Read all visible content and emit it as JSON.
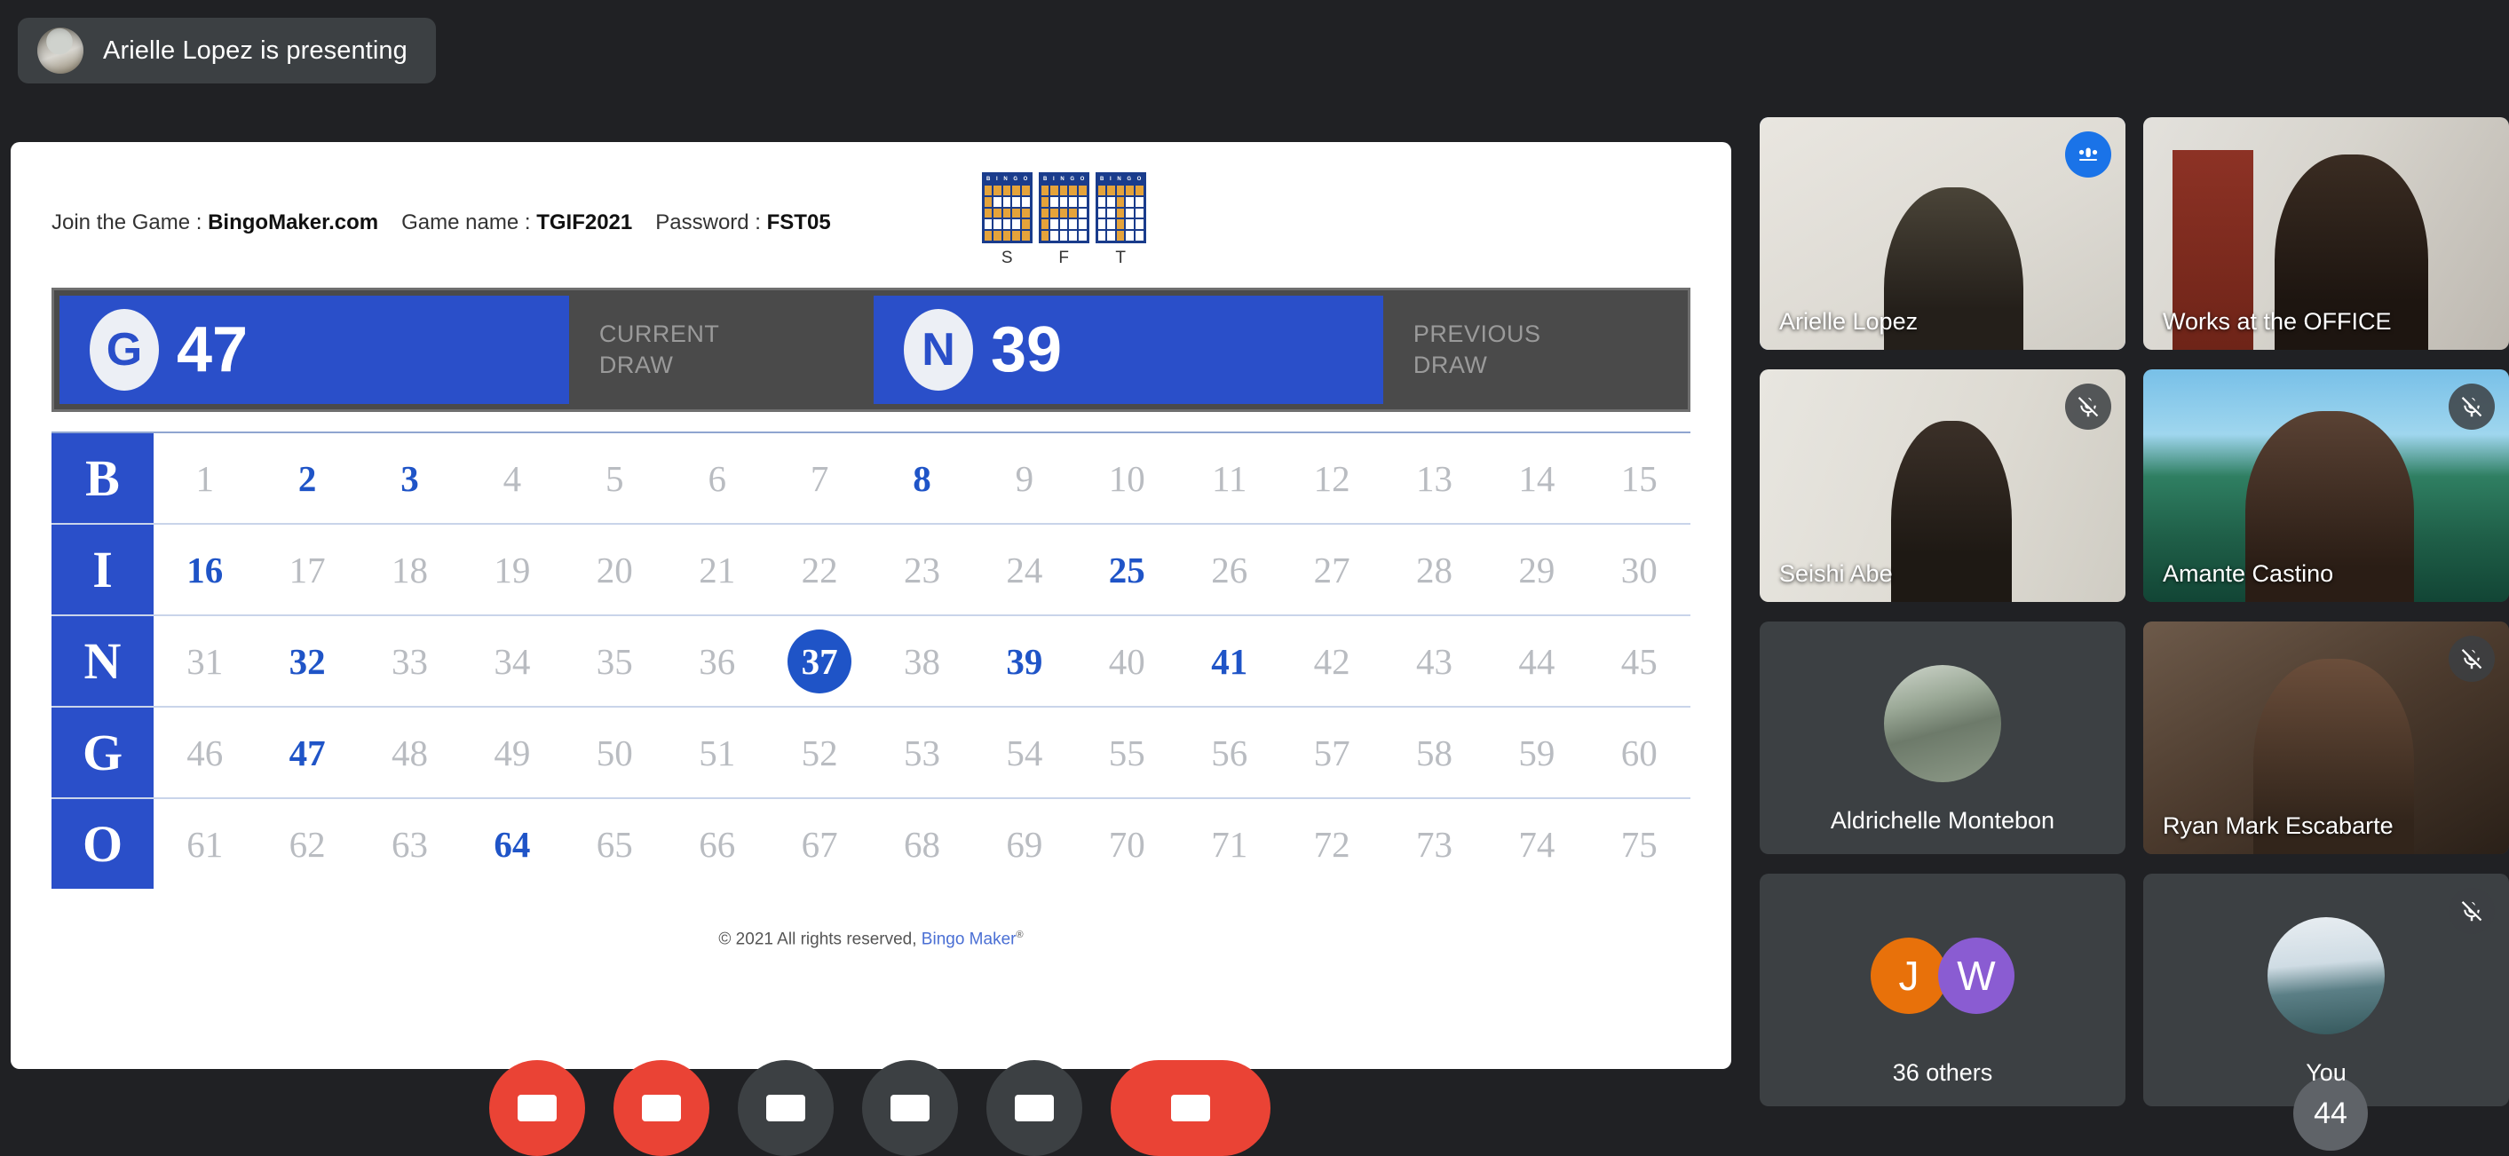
{
  "banner": {
    "presenter_text": "Arielle Lopez is presenting",
    "avatar_name": "presenter-avatar"
  },
  "presentation": {
    "join": {
      "join_label": "Join the Game : ",
      "join_value": "BingoMaker.com",
      "game_name_label": "Game name : ",
      "game_name_value": "TGIF2021",
      "password_label": "Password : ",
      "password_value": "FST05"
    },
    "mini_cards": [
      {
        "header": "B I N G O",
        "letter": "S"
      },
      {
        "header": "B I N G O",
        "letter": "F"
      },
      {
        "header": "B I N G O",
        "letter": "T"
      }
    ],
    "draws": [
      {
        "letter": "G",
        "number": "47",
        "label_line1": "CURRENT",
        "label_line2": "DRAW"
      },
      {
        "letter": "N",
        "number": "39",
        "label_line1": "PREVIOUS",
        "label_line2": "DRAW"
      }
    ],
    "board": {
      "rows": [
        {
          "letter": "B",
          "numbers": [
            1,
            2,
            3,
            4,
            5,
            6,
            7,
            8,
            9,
            10,
            11,
            12,
            13,
            14,
            15
          ]
        },
        {
          "letter": "I",
          "numbers": [
            16,
            17,
            18,
            19,
            20,
            21,
            22,
            23,
            24,
            25,
            26,
            27,
            28,
            29,
            30
          ]
        },
        {
          "letter": "N",
          "numbers": [
            31,
            32,
            33,
            34,
            35,
            36,
            37,
            38,
            39,
            40,
            41,
            42,
            43,
            44,
            45
          ]
        },
        {
          "letter": "G",
          "numbers": [
            46,
            47,
            48,
            49,
            50,
            51,
            52,
            53,
            54,
            55,
            56,
            57,
            58,
            59,
            60
          ]
        },
        {
          "letter": "O",
          "numbers": [
            61,
            62,
            63,
            64,
            65,
            66,
            67,
            68,
            69,
            70,
            71,
            72,
            73,
            74,
            75
          ]
        }
      ],
      "called": [
        2,
        3,
        8,
        16,
        25,
        32,
        37,
        39,
        41,
        47,
        64
      ],
      "current": 37
    },
    "footer": {
      "copyright": "© 2021 All rights reserved, ",
      "brand": "Bingo Maker",
      "reg": "®"
    }
  },
  "participants": [
    {
      "name": "Arielle Lopez",
      "type": "video",
      "scene": "sc-arielle",
      "active": true,
      "badge": "speaking",
      "name_align": "left"
    },
    {
      "name": "Works at the OFFICE",
      "type": "video",
      "scene": "sc-office",
      "active": false,
      "badge": "none",
      "name_align": "left"
    },
    {
      "name": "Seishi Abe",
      "type": "video",
      "scene": "sc-seishi",
      "active": false,
      "badge": "muted",
      "name_align": "left"
    },
    {
      "name": "Amante Castino",
      "type": "video",
      "scene": "sc-amante",
      "active": false,
      "badge": "muted",
      "name_align": "left"
    },
    {
      "name": "Aldrichelle Montebon",
      "type": "avatar",
      "scene": "ava-shoes",
      "active": false,
      "badge": "none",
      "name_align": "center"
    },
    {
      "name": "Ryan Mark Escabarte",
      "type": "video",
      "scene": "sc-ryan",
      "active": false,
      "badge": "muted",
      "name_align": "left"
    },
    {
      "name": "36 others",
      "type": "initials",
      "scene": "",
      "active": false,
      "badge": "none",
      "name_align": "center",
      "initials": [
        {
          "letter": "J",
          "color": "#e8710a"
        },
        {
          "letter": "W",
          "color": "#8a5cd2"
        }
      ]
    },
    {
      "name": "You",
      "type": "avatar",
      "scene": "ava-island",
      "active": false,
      "badge": "muted",
      "name_align": "center"
    }
  ],
  "toolbar": {
    "buttons": [
      {
        "name": "microphone-button",
        "style": "danger"
      },
      {
        "name": "camera-button",
        "style": "danger"
      },
      {
        "name": "captions-button",
        "style": "normal"
      },
      {
        "name": "present-button",
        "style": "normal"
      },
      {
        "name": "more-options-button",
        "style": "normal"
      },
      {
        "name": "leave-call-button",
        "style": "danger-wide"
      }
    ],
    "participant_count": "44"
  },
  "colors": {
    "accent_blue": "#2a4fc9",
    "active_border": "#8ab4f8",
    "danger_red": "#ea4335",
    "surface": "#3c4043",
    "background": "#202124"
  }
}
